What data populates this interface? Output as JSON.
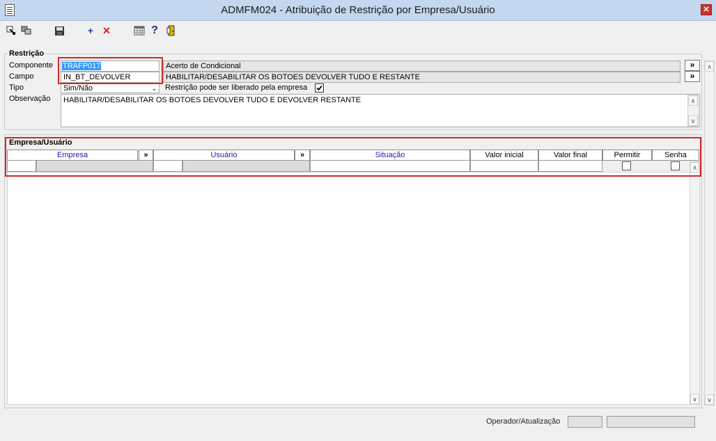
{
  "window": {
    "title": "ADMFM024 - Atribuição de Restrição por Empresa/Usuário"
  },
  "toolbar": {
    "nav_first_icon": "navigate-first-icon",
    "nav_copy_icon": "copy-icon",
    "save_icon": "save-icon",
    "add_icon": "plus-icon",
    "delete_icon": "delete-x-icon",
    "calendar_icon": "table-icon",
    "help_icon": "help-icon",
    "exit_icon": "exit-door-icon"
  },
  "restricao": {
    "group_title": "Restrição",
    "componente_label": "Componente",
    "componente_code": "TRAFP017",
    "componente_desc": "Acerto de Condicional",
    "campo_label": "Campo",
    "campo_code": "IN_BT_DEVOLVER",
    "campo_desc": "HABILITAR/DESABILITAR OS BOTOES DEVOLVER TUDO E RESTANTE",
    "tipo_label": "Tipo",
    "tipo_value": "Sim/Não",
    "liberado_label": "Restrição pode ser liberado pela empresa",
    "observacao_label": "Observação",
    "observacao_value": "HABILITAR/DESABILITAR OS BOTOES DEVOLVER TUDO E DEVOLVER RESTANTE",
    "lookup_symbol": "»"
  },
  "empresa_usuario": {
    "group_title": "Empresa/Usuário",
    "columns": {
      "empresa": "Empresa",
      "usuario": "Usuário",
      "situacao": "Situação",
      "valor_inicial": "Valor inicial",
      "valor_final": "Valor final",
      "permitir": "Permitir",
      "senha": "Senha"
    },
    "lookup_symbol": "»"
  },
  "status": {
    "operador_label": "Operador/Atualização"
  },
  "colors": {
    "highlight": "#d1282b",
    "selection": "#3399ff",
    "title_bar": "#c4d7ef"
  }
}
